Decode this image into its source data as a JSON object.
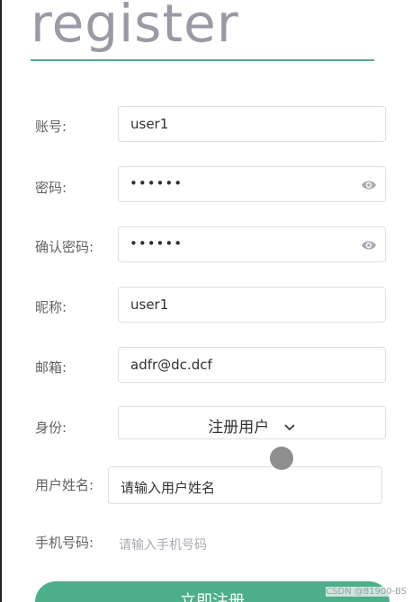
{
  "page": {
    "title": "register",
    "colors": {
      "accent": "#4caf8a",
      "border": "#dcdfe6",
      "placeholder": "#a8abb2"
    }
  },
  "form": {
    "account": {
      "label": "账号:",
      "value": "user1"
    },
    "password": {
      "label": "密码:",
      "value": "••••••",
      "icon": "eye-icon"
    },
    "confirm_password": {
      "label": "确认密码:",
      "value": "••••••",
      "icon": "eye-icon"
    },
    "nickname": {
      "label": "昵称:",
      "value": "user1"
    },
    "email": {
      "label": "邮箱:",
      "value": "adfr@dc.dcf"
    },
    "identity": {
      "label": "身份:",
      "selected": "注册用户",
      "icon": "chevron-down-icon"
    },
    "real_name": {
      "label": "用户姓名:",
      "placeholder": "请输入用户姓名"
    },
    "phone": {
      "label": "手机号码:",
      "placeholder": "请输入手机号码"
    },
    "submit_label": "立即注册"
  },
  "watermark": "CSDN @81900-BS"
}
